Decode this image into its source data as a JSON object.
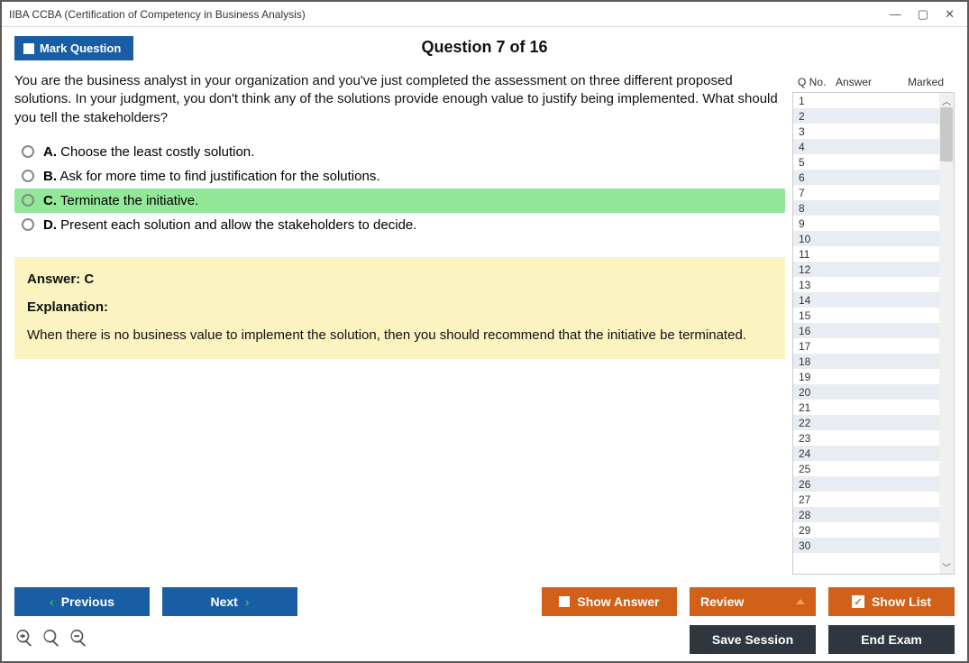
{
  "window": {
    "title": "IIBA CCBA (Certification of Competency in Business Analysis)"
  },
  "header": {
    "mark_label": "Mark Question",
    "counter": "Question 7 of 16"
  },
  "question": {
    "text": "You are the business analyst in your organization and you've just completed the assessment on three different proposed solutions. In your judgment, you don't think any of the solutions provide enough value to justify being implemented. What should you tell the stakeholders?",
    "options": [
      {
        "letter": "A.",
        "text": "Choose the least costly solution.",
        "correct": false
      },
      {
        "letter": "B.",
        "text": "Ask for more time to find justification for the solutions.",
        "correct": false
      },
      {
        "letter": "C.",
        "text": "Terminate the initiative.",
        "correct": true
      },
      {
        "letter": "D.",
        "text": "Present each solution and allow the stakeholders to decide.",
        "correct": false
      }
    ]
  },
  "answer_panel": {
    "answer_label": "Answer: C",
    "explanation_label": "Explanation:",
    "explanation_text": "When there is no business value to implement the solution, then you should recommend that the initiative be terminated."
  },
  "side": {
    "col_qno": "Q No.",
    "col_answer": "Answer",
    "col_marked": "Marked",
    "rows": 30
  },
  "buttons": {
    "previous": "Previous",
    "next": "Next",
    "show_answer": "Show Answer",
    "review": "Review",
    "show_list": "Show List",
    "save_session": "Save Session",
    "end_exam": "End Exam"
  }
}
